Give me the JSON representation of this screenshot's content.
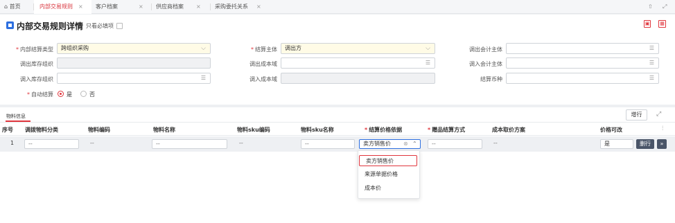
{
  "tabs": [
    {
      "label": "首页",
      "icon": "home-icon"
    },
    {
      "label": "内部交易规则",
      "active": true
    },
    {
      "label": "客户档案"
    },
    {
      "label": "供应商档案"
    },
    {
      "label": "采购委托关系"
    }
  ],
  "tab_close": "×",
  "header": {
    "title": "内部交易规则详情",
    "required_only_label": "只看必填项"
  },
  "form": {
    "settlement_type_label": "内部结算类型",
    "settlement_type_value": "跨组织采购",
    "settlement_entity_label": "结算主体",
    "settlement_entity_value": "调出方",
    "out_accounting_label": "调出会计主体",
    "out_stock_org_label": "调出库存组织",
    "out_cost_domain_label": "调出成本域",
    "in_accounting_label": "调入会计主体",
    "in_stock_org_label": "调入库存组织",
    "in_cost_domain_label": "调入成本域",
    "currency_label": "结算币种",
    "auto_settle_label": "自动结算",
    "auto_settle_yes": "是",
    "auto_settle_no": "否"
  },
  "material": {
    "tab_label": "物料信息",
    "add_row_button": "增行",
    "columns": [
      "序号",
      "调拨物料分类",
      "物料编码",
      "物料名称",
      "物料sku编码",
      "物料sku名称",
      "结算价格依据",
      "赠品结算方式",
      "成本取价方案",
      "价格可改"
    ],
    "row": {
      "index": "1",
      "category": "--",
      "code": "--",
      "name": "--",
      "sku_code": "--",
      "sku_name": "--",
      "price_basis": "卖方销售价",
      "gift_method": "--",
      "cost_scheme": "--",
      "price_editable": "是",
      "delete_button": "删行"
    },
    "dropdown_options": [
      "卖方销售价",
      "来源单据价格",
      "成本价"
    ]
  },
  "colors": {
    "accent": "#e0353c",
    "brand": "#2d6fe0",
    "required_bg": "#fffbe6"
  }
}
